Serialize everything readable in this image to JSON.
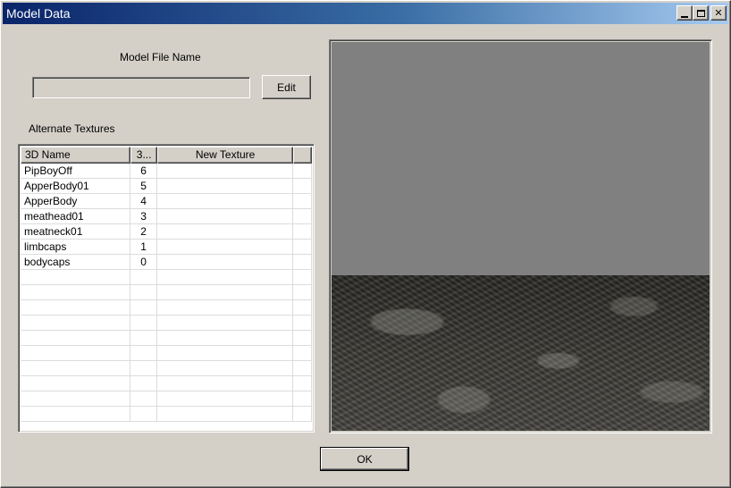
{
  "window": {
    "title": "Model Data",
    "buttons": {
      "minimize": "minimize-icon",
      "maximize": "maximize-icon",
      "close": "close-icon",
      "close_glyph": "✕"
    }
  },
  "model_file": {
    "label": "Model File Name",
    "value": "",
    "edit_label": "Edit"
  },
  "alternate_textures": {
    "label": "Alternate Textures",
    "columns": [
      "3D Name",
      "3...",
      "New Texture",
      ""
    ],
    "rows": [
      {
        "name": "PipBoyOff",
        "index": "6",
        "texture": ""
      },
      {
        "name": "ApperBody01",
        "index": "5",
        "texture": ""
      },
      {
        "name": "ApperBody",
        "index": "4",
        "texture": ""
      },
      {
        "name": "meathead01",
        "index": "3",
        "texture": ""
      },
      {
        "name": "meatneck01",
        "index": "2",
        "texture": ""
      },
      {
        "name": "limbcaps",
        "index": "1",
        "texture": ""
      },
      {
        "name": "bodycaps",
        "index": "0",
        "texture": ""
      }
    ],
    "empty_rows": 10
  },
  "ok_label": "OK",
  "colors": {
    "face": "#d4d0c8",
    "title_start": "#0a246a",
    "title_end": "#a6caf0",
    "sky": "#808080"
  }
}
